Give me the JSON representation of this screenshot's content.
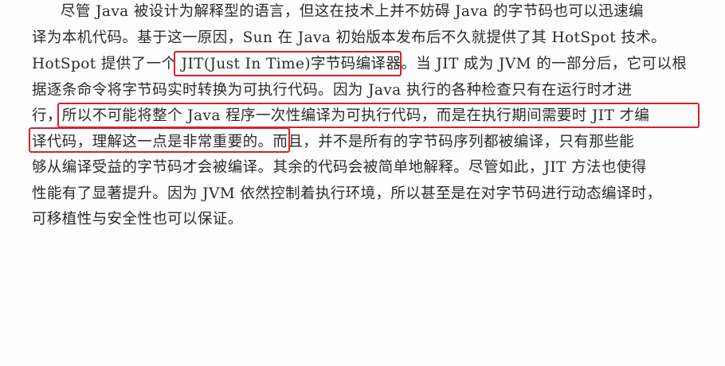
{
  "paragraph": {
    "lines": [
      "尽管 Java 被设计为解释型的语言，但这在技术上并不妨碍 Java 的字节码也可以迅速编",
      "译为本机代码。基于这一原因，Sun 在 Java 初始版本发布后不久就提供了其 HotSpot 技术。",
      "HotSpot 提供了一个 JIT(Just In Time)字节码编译器。当 JIT 成为 JVM 的一部分后，它可以根",
      "据逐条命令将字节码实时转换为可执行代码。因为 Java 执行的各种检查只有在运行时才进",
      "行，所以不可能将整个 Java 程序一次性编译为可执行代码，而是在执行期间需要时 JIT 才编",
      "译代码，理解这一点是非常重要的。而且，并不是所有的字节码序列都被编译，只有那些能",
      "够从编译受益的字节码才会被编译。其余的代码会被简单地解释。尽管如此，JIT 方法也使得",
      "性能有了显著提升。因为 JVM 依然控制着执行环境，所以甚至是在对字节码进行动态编译时，",
      "可移植性与安全性也可以保证。"
    ]
  },
  "highlight_color": "#d9202a"
}
